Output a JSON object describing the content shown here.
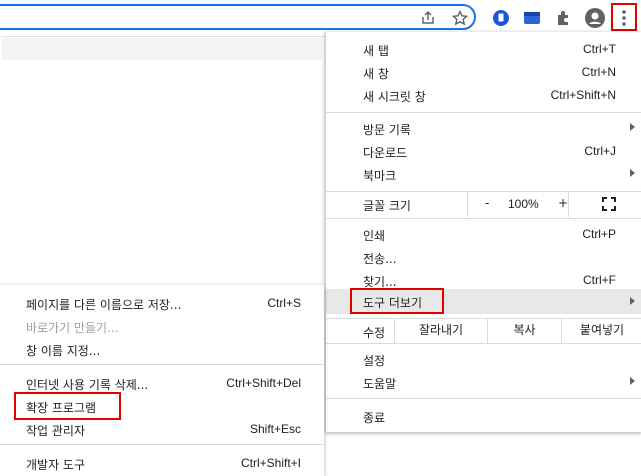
{
  "colors": {
    "highlight_border": "#e00000",
    "omnibox_border": "#1a73e8",
    "menu_hover": "#e8e8e8"
  },
  "toolbar": {
    "icons": [
      "share-icon",
      "bookmark-star-icon",
      "extension-blue-icon",
      "profile-card-icon",
      "puzzle-icon",
      "account-avatar-icon",
      "kebab-menu-icon"
    ]
  },
  "menu": {
    "new_tab": {
      "label": "새 탭",
      "shortcut": "Ctrl+T"
    },
    "new_window": {
      "label": "새 창",
      "shortcut": "Ctrl+N"
    },
    "incognito": {
      "label": "새 시크릿 창",
      "shortcut": "Ctrl+Shift+N"
    },
    "history": {
      "label": "방문 기록"
    },
    "downloads": {
      "label": "다운로드",
      "shortcut": "Ctrl+J"
    },
    "bookmarks": {
      "label": "북마크"
    },
    "zoom": {
      "label": "글꼴 크기",
      "minus": "-",
      "value": "100%",
      "plus": "+"
    },
    "print": {
      "label": "인쇄",
      "shortcut": "Ctrl+P"
    },
    "cast": {
      "label": "전송..."
    },
    "find": {
      "label": "찾기...",
      "shortcut": "Ctrl+F"
    },
    "more_tools": {
      "label": "도구 더보기"
    },
    "edit": {
      "label": "수정",
      "cut": "잘라내기",
      "copy": "복사",
      "paste": "붙여넣기"
    },
    "settings": {
      "label": "설정"
    },
    "help": {
      "label": "도움말"
    },
    "exit": {
      "label": "종료"
    }
  },
  "submenu": {
    "save_page": {
      "label": "페이지를 다른 이름으로 저장...",
      "shortcut": "Ctrl+S"
    },
    "create_shortcut": {
      "label": "바로가기 만들기..."
    },
    "name_window": {
      "label": "창 이름 지정..."
    },
    "clear_data": {
      "label": "인터넷 사용 기록 삭제...",
      "shortcut": "Ctrl+Shift+Del"
    },
    "extensions": {
      "label": "확장 프로그램"
    },
    "task_manager": {
      "label": "작업 관리자",
      "shortcut": "Shift+Esc"
    },
    "dev_tools": {
      "label": "개발자 도구",
      "shortcut": "Ctrl+Shift+I"
    }
  }
}
